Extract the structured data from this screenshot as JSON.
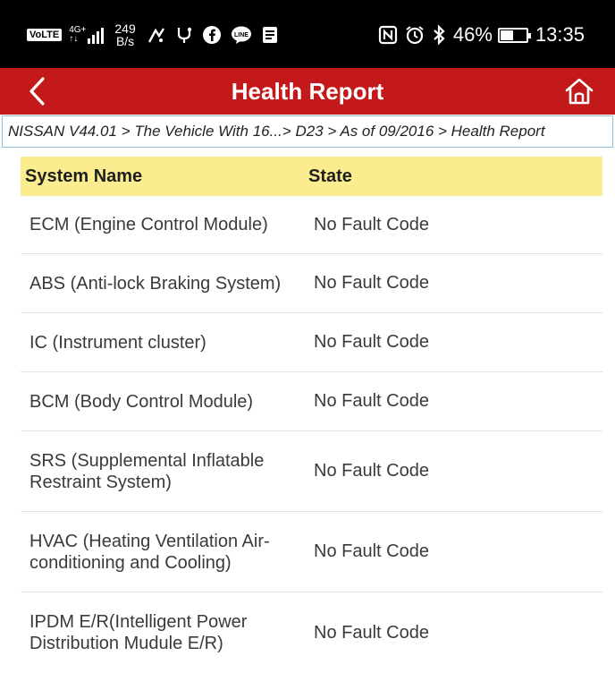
{
  "status_bar": {
    "volte": "VoLTE",
    "network": "4G+",
    "network_sub": "↑↓",
    "speed_value": "249",
    "speed_unit": "B/s",
    "battery": "46%",
    "time": "13:35"
  },
  "header": {
    "title": "Health Report",
    "back_icon": "chevron-left-icon",
    "home_icon": "home-icon"
  },
  "breadcrumb": "NISSAN V44.01 > The Vehicle With 16...> D23 > As of 09/2016 > Health Report",
  "table": {
    "headers": {
      "system_name": "System Name",
      "state": "State"
    },
    "rows": [
      {
        "system": "ECM (Engine Control Module)",
        "state": "No Fault Code"
      },
      {
        "system": "ABS (Anti-lock Braking System)",
        "state": "No Fault Code"
      },
      {
        "system": "IC (Instrument cluster)",
        "state": "No Fault Code"
      },
      {
        "system": "BCM (Body Control Module)",
        "state": "No Fault Code"
      },
      {
        "system": "SRS (Supplemental Inflatable Restraint System)",
        "state": "No Fault Code"
      },
      {
        "system": "HVAC (Heating Ventilation Air-conditioning and Cooling)",
        "state": "No Fault Code"
      },
      {
        "system": "IPDM E/R(Intelligent Power Distribution Mudule E/R)",
        "state": "No Fault Code"
      }
    ]
  },
  "colors": {
    "header_red": "#c3191a",
    "table_header_yellow": "#fbec8f",
    "breadcrumb_border": "#8fc0de"
  }
}
